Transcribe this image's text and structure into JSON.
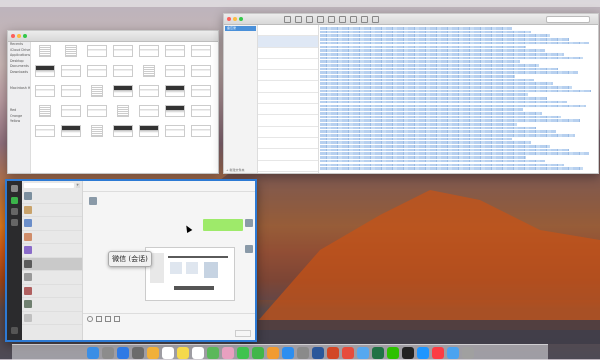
{
  "finder": {
    "sidebar": [
      "Recents",
      "iCloud Drive",
      "Applications",
      "Desktop",
      "Documents",
      "Downloads",
      "",
      "",
      "Macintosh HD",
      "",
      "",
      "",
      "Red",
      "Orange",
      "Yellow"
    ],
    "files": [
      {
        "name": "",
        "kind": "doc"
      },
      {
        "name": "",
        "kind": "doc"
      },
      {
        "name": "",
        "kind": "img"
      },
      {
        "name": "",
        "kind": "img"
      },
      {
        "name": "",
        "kind": "img"
      },
      {
        "name": "",
        "kind": "img"
      },
      {
        "name": "",
        "kind": "img"
      },
      {
        "name": "",
        "kind": "dark"
      },
      {
        "name": "",
        "kind": "img"
      },
      {
        "name": "",
        "kind": "img"
      },
      {
        "name": "",
        "kind": "img"
      },
      {
        "name": "",
        "kind": "doc"
      },
      {
        "name": "",
        "kind": "img"
      },
      {
        "name": "",
        "kind": "img"
      },
      {
        "name": "",
        "kind": "img"
      },
      {
        "name": "",
        "kind": "img"
      },
      {
        "name": "",
        "kind": "doc"
      },
      {
        "name": "",
        "kind": "dark"
      },
      {
        "name": "",
        "kind": "img"
      },
      {
        "name": "",
        "kind": "dark"
      },
      {
        "name": "",
        "kind": "img"
      },
      {
        "name": "",
        "kind": "doc"
      },
      {
        "name": "",
        "kind": "img"
      },
      {
        "name": "",
        "kind": "img"
      },
      {
        "name": "",
        "kind": "doc"
      },
      {
        "name": "",
        "kind": "img"
      },
      {
        "name": "",
        "kind": "dark"
      },
      {
        "name": "",
        "kind": "img"
      },
      {
        "name": "",
        "kind": "img"
      },
      {
        "name": "",
        "kind": "dark"
      },
      {
        "name": "",
        "kind": "doc"
      },
      {
        "name": "",
        "kind": "dark"
      },
      {
        "name": "",
        "kind": "dark"
      },
      {
        "name": "",
        "kind": "img"
      },
      {
        "name": "",
        "kind": "img"
      }
    ]
  },
  "notes": {
    "folder_selected": "备忘录",
    "folder_footer": "+ 新建文件夹",
    "items": [
      {
        "title": "",
        "sub": "",
        "selected": false
      },
      {
        "title": "",
        "sub": "",
        "selected": true
      },
      {
        "title": "",
        "sub": "",
        "selected": false
      },
      {
        "title": "",
        "sub": "",
        "selected": false
      },
      {
        "title": "",
        "sub": "",
        "selected": false
      },
      {
        "title": "",
        "sub": "",
        "selected": false
      },
      {
        "title": "",
        "sub": "",
        "selected": false
      },
      {
        "title": "",
        "sub": "",
        "selected": false
      },
      {
        "title": "",
        "sub": "",
        "selected": false
      },
      {
        "title": "",
        "sub": "",
        "selected": false
      },
      {
        "title": "",
        "sub": "",
        "selected": false
      },
      {
        "title": "",
        "sub": "",
        "selected": false
      },
      {
        "title": "",
        "sub": "",
        "selected": false
      },
      {
        "title": "",
        "sub": "",
        "selected": false
      },
      {
        "title": "",
        "sub": "",
        "selected": false
      }
    ],
    "body_lines": 48
  },
  "wechat": {
    "search_placeholder": "",
    "chats": [
      {
        "name": "",
        "msg": "",
        "selected": false
      },
      {
        "name": "",
        "msg": "",
        "selected": false
      },
      {
        "name": "",
        "msg": "",
        "selected": false
      },
      {
        "name": "",
        "msg": "",
        "selected": false
      },
      {
        "name": "",
        "msg": "",
        "selected": false
      },
      {
        "name": "",
        "msg": "",
        "selected": true
      },
      {
        "name": "",
        "msg": "",
        "selected": false
      },
      {
        "name": "",
        "msg": "",
        "selected": false
      },
      {
        "name": "",
        "msg": "",
        "selected": false
      },
      {
        "name": "",
        "msg": "",
        "selected": false
      }
    ],
    "header_title": "",
    "timestamps": [
      "",
      "",
      ""
    ],
    "send_label": ""
  },
  "tooltip": "微信 (会话)",
  "colors": {
    "accent": "#2d7ad4",
    "bubble": "#9eea6a",
    "notes_selection": "#4a90d9"
  },
  "dock_icons": [
    "finder-icon",
    "launchpad-icon",
    "safari-icon",
    "rocket-icon",
    "photos-icon",
    "calendar-icon",
    "notes-icon",
    "reminders-icon",
    "maps-icon",
    "photos2-icon",
    "messages-icon",
    "facetime-icon",
    "books-icon",
    "appstore-icon",
    "preferences-icon",
    "word-icon",
    "powerpoint-icon",
    "chrome-icon",
    "folder-icon",
    "excel-icon",
    "wechat-icon",
    "terminal-icon",
    "qq-icon",
    "music-icon",
    "downloads-icon",
    "trash-icon"
  ]
}
